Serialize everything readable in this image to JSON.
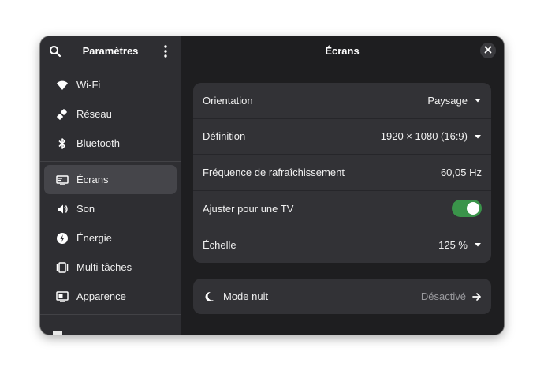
{
  "sidebar": {
    "title": "Paramètres",
    "search_icon": "search-icon",
    "menu_icon": "kebab-menu-icon",
    "items": [
      {
        "label": "Wi-Fi",
        "icon": "wifi-icon"
      },
      {
        "label": "Réseau",
        "icon": "network-icon"
      },
      {
        "label": "Bluetooth",
        "icon": "bluetooth-icon"
      },
      {
        "label": "Écrans",
        "icon": "display-icon",
        "active": true
      },
      {
        "label": "Son",
        "icon": "speaker-icon"
      },
      {
        "label": "Énergie",
        "icon": "power-icon"
      },
      {
        "label": "Multi-tâches",
        "icon": "multitasking-icon"
      },
      {
        "label": "Apparence",
        "icon": "appearance-icon"
      }
    ]
  },
  "main": {
    "title": "Écrans",
    "close_icon": "close-icon",
    "settings": [
      {
        "label": "Orientation",
        "value": "Paysage",
        "type": "dropdown"
      },
      {
        "label": "Définition",
        "value": "1920 × 1080 (16:9)",
        "type": "dropdown"
      },
      {
        "label": "Fréquence de rafraîchissement",
        "value": "60,05 Hz",
        "type": "static"
      },
      {
        "label": "Ajuster pour une TV",
        "value": true,
        "type": "toggle"
      },
      {
        "label": "Échelle",
        "value": "125 %",
        "type": "dropdown"
      }
    ],
    "night_mode": {
      "label": "Mode nuit",
      "value": "Désactivé",
      "icon": "moon-icon"
    }
  },
  "colors": {
    "accent_toggle": "#3a944a",
    "sidebar_bg": "#2e2e32",
    "main_bg": "#1e1e20",
    "card_bg": "#323236"
  }
}
